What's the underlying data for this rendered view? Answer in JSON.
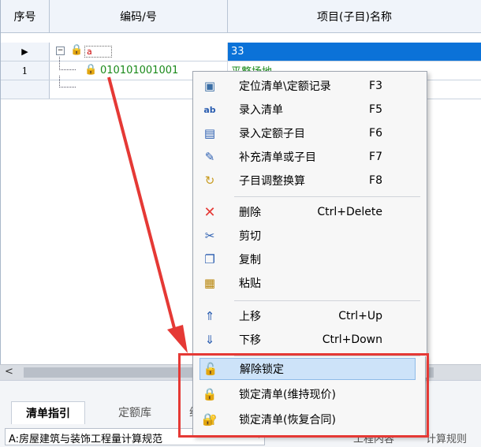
{
  "table": {
    "headers": {
      "seq": "序号",
      "code": "编码/号",
      "name": "项目(子目)名称"
    },
    "rows": [
      {
        "seq": "",
        "code": "a",
        "name": "33"
      },
      {
        "seq": "1",
        "code": "010101001001",
        "name": "平整场地"
      }
    ]
  },
  "context_menu": {
    "items": [
      {
        "label": "定位清单\\定额记录",
        "shortcut": "F3",
        "icon": "locate-icon"
      },
      {
        "label": "录入清单",
        "shortcut": "F5",
        "icon": "ab-entry-icon"
      },
      {
        "label": "录入定额子目",
        "shortcut": "F6",
        "icon": "doc-entry-icon"
      },
      {
        "label": "补充清单或子目",
        "shortcut": "F7",
        "icon": "wrench-icon"
      },
      {
        "label": "子目调整换算",
        "shortcut": "F8",
        "icon": "adjust-icon"
      },
      {
        "label": "删除",
        "shortcut": "Ctrl+Delete",
        "icon": "delete-icon"
      },
      {
        "label": "剪切",
        "shortcut": "",
        "icon": "cut-icon"
      },
      {
        "label": "复制",
        "shortcut": "",
        "icon": "copy-icon"
      },
      {
        "label": "粘贴",
        "shortcut": "",
        "icon": "paste-icon"
      },
      {
        "label": "上移",
        "shortcut": "Ctrl+Up",
        "icon": "move-up-icon"
      },
      {
        "label": "下移",
        "shortcut": "Ctrl+Down",
        "icon": "move-down-icon"
      },
      {
        "label": "解除锁定",
        "shortcut": "",
        "icon": "unlock-icon"
      },
      {
        "label": "锁定清单(维持现价)",
        "shortcut": "",
        "icon": "lock-icon"
      },
      {
        "label": "锁定清单(恢复合同)",
        "shortcut": "",
        "icon": "lock-restore-icon"
      }
    ]
  },
  "bottom_panel": {
    "tabs": [
      "清单指引",
      "定额库",
      "综"
    ],
    "library": "A:房屋建筑与装饰工程量计算规范",
    "links": [
      "工程内容",
      "计算规则"
    ]
  },
  "colors": {
    "selection": "#0b72d8",
    "highlight": "#cde3f9",
    "annotation": "#e53935",
    "code_green": "#1a8a1a"
  }
}
